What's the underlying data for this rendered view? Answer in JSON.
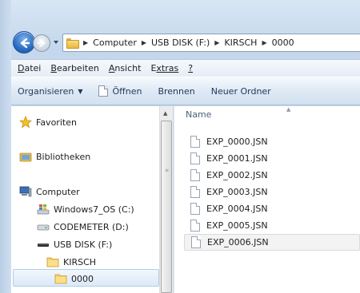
{
  "address": {
    "crumbs": [
      "Computer",
      "USB DISK (F:)",
      "KIRSCH",
      "0000"
    ]
  },
  "menu": {
    "items": [
      {
        "u": "D",
        "rest": "atei"
      },
      {
        "u": "B",
        "rest": "earbeiten"
      },
      {
        "u": "A",
        "rest": "nsicht"
      },
      {
        "u": "E",
        "rest": "xtras",
        "pre": ""
      },
      {
        "u": "?",
        "rest": ""
      }
    ]
  },
  "toolbar": {
    "organize": "Organisieren",
    "open": "Öffnen",
    "burn": "Brennen",
    "new_folder": "Neuer Ordner"
  },
  "nav": {
    "favorites": "Favoriten",
    "libraries": "Bibliotheken",
    "computer": "Computer",
    "drive_c": "Windows7_OS (C:)",
    "drive_d": "CODEMETER (D:)",
    "drive_f": "USB DISK (F:)",
    "folder_kirsch": "KIRSCH",
    "folder_0000": "0000"
  },
  "files": {
    "column_name": "Name",
    "items": [
      "EXP_0000.JSN",
      "EXP_0001.JSN",
      "EXP_0002.JSN",
      "EXP_0003.JSN",
      "EXP_0004.JSN",
      "EXP_0005.JSN",
      "EXP_0006.JSN"
    ]
  },
  "colors": {
    "accent": "#2b6cc4",
    "selection": "#dce9f8"
  }
}
